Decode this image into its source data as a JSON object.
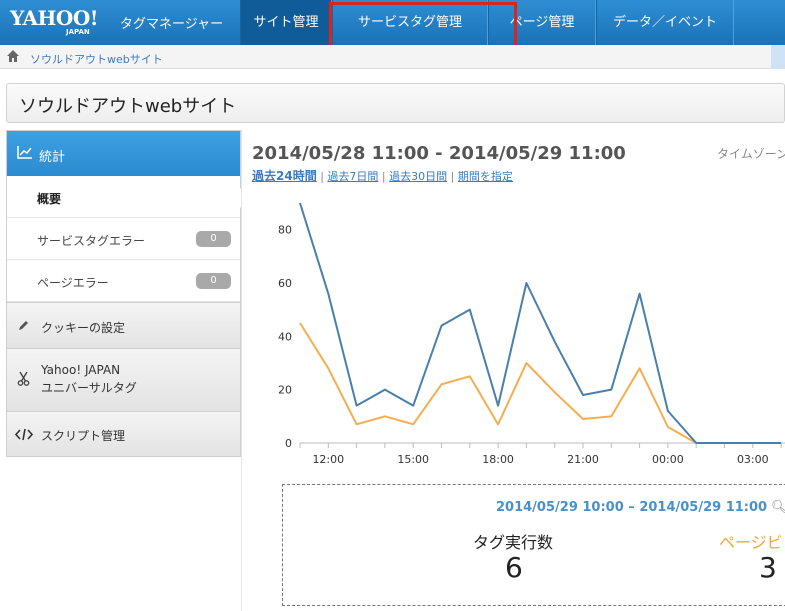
{
  "header": {
    "logo_yahoo": "YAHOO!",
    "logo_japan": "JAPAN",
    "product": "タグマネージャー",
    "tabs": [
      {
        "label": "サイト管理",
        "active": true
      },
      {
        "label": "サービスタグ管理",
        "active": false
      },
      {
        "label": "ページ管理",
        "active": false
      },
      {
        "label": "データ／イベント",
        "active": false
      }
    ]
  },
  "breadcrumb": {
    "icon": "home-icon",
    "label": "ソウルドアウトwebサイト"
  },
  "site_title": "ソウルドアウトwebサイト",
  "sidebar": {
    "stats_label": "統計",
    "sub_items": [
      {
        "label": "概要",
        "active": true
      },
      {
        "label": "サービスタグエラー",
        "badge": "0"
      },
      {
        "label": "ページエラー",
        "badge": "0"
      }
    ],
    "items": [
      {
        "label": "クッキーの設定",
        "icon": "pencil-icon"
      },
      {
        "label_line1": "Yahoo! JAPAN",
        "label_line2": "ユニバーサルタグ",
        "icon": "scissors-icon"
      },
      {
        "label": "スクリプト管理",
        "icon": "code-icon"
      }
    ]
  },
  "main": {
    "date_range": "2014/05/28 11:00 - 2014/05/29 11:00",
    "timezone": "タイムゾーン",
    "periods": [
      "過去24時間",
      "過去7日間",
      "過去30日間",
      "期間を指定"
    ],
    "period_separator": "|"
  },
  "chart_data": {
    "type": "line",
    "x": [
      "11:00",
      "12:00",
      "13:00",
      "14:00",
      "15:00",
      "16:00",
      "17:00",
      "18:00",
      "19:00",
      "20:00",
      "21:00",
      "22:00",
      "23:00",
      "00:00",
      "01:00",
      "02:00",
      "03:00",
      "04:00"
    ],
    "x_tick_labels": [
      "12:00",
      "15:00",
      "18:00",
      "21:00",
      "00:00",
      "03:00"
    ],
    "series": [
      {
        "color": "#4a7fab",
        "values": [
          90,
          56,
          14,
          20,
          14,
          44,
          50,
          14,
          60,
          38,
          18,
          20,
          56,
          12,
          0,
          0,
          0,
          0
        ]
      },
      {
        "color": "#f4ae4f",
        "values": [
          45,
          28,
          7,
          10,
          7,
          22,
          25,
          7,
          30,
          19,
          9,
          10,
          28,
          6,
          0,
          0,
          0,
          0
        ]
      }
    ],
    "ylim": [
      0,
      90
    ],
    "y_ticks": [
      0,
      20,
      40,
      60,
      80
    ],
    "grid": false
  },
  "summary": {
    "range": "2014/05/29 10:00 – 2014/05/29 11:00",
    "metric1_label": "タグ実行数",
    "metric1_value": "6",
    "metric2_label": "ページビ",
    "metric2_value": "3"
  }
}
